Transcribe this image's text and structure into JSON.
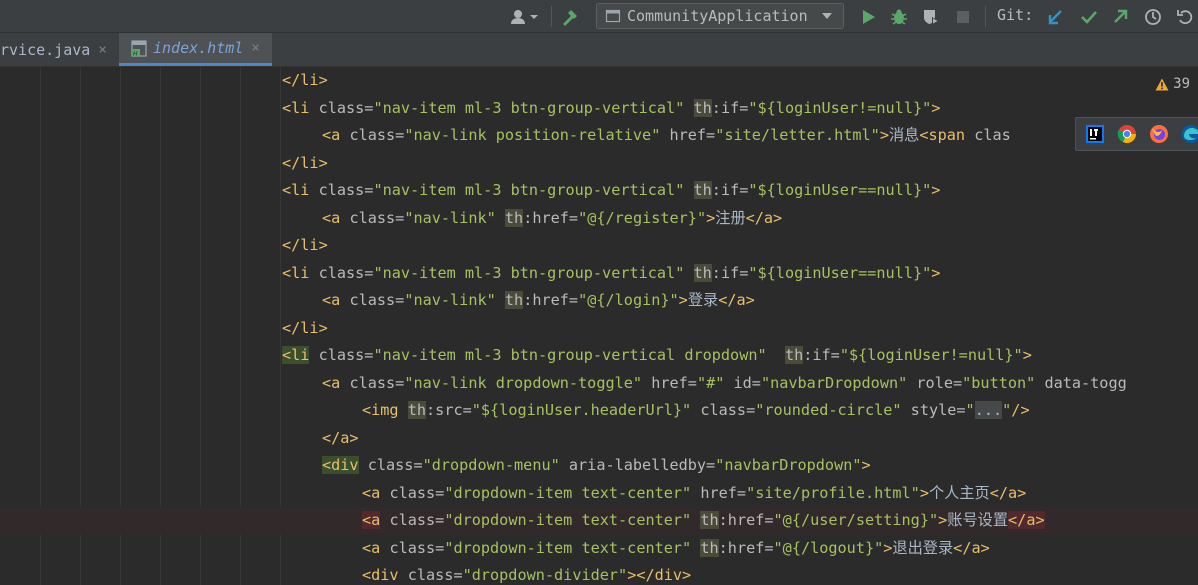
{
  "toolbar": {
    "run_config": "CommunityApplication",
    "git_label": "Git:",
    "icons": [
      "user-icon",
      "build-hammer-icon",
      "run-icon",
      "debug-icon",
      "coverage-icon",
      "stop-icon",
      "git-update-icon",
      "git-commit-icon",
      "git-push-icon",
      "history-icon",
      "rollback-icon"
    ],
    "colors": {
      "run": "#59a869",
      "debug": "#59a869",
      "git_update": "#3592c4",
      "git_commit": "#59a869",
      "git_push": "#59a869"
    }
  },
  "tabs": [
    {
      "label": "rvice.java",
      "close": "×",
      "active": false
    },
    {
      "label": "index.html",
      "close": "×",
      "active": true
    }
  ],
  "editor": {
    "warning_count": "39",
    "browsers": [
      "intellij-icon",
      "chrome-icon",
      "firefox-icon",
      "edge-icon"
    ],
    "lines": [
      {
        "t1": "</li>"
      },
      {
        "t1": "<li",
        "a1": " class=",
        "v1": "\"nav-item ml-3 btn-group-vertical\"",
        "sp": " ",
        "ns": "th",
        "a2": ":if=",
        "v2": "\"${loginUser!=null}\"",
        "t2": ">"
      },
      {
        "t1": "<a",
        "a1": " class=",
        "v1": "\"nav-link position-relative\"",
        "a2": " href=",
        "v2": "\"site/letter.html\"",
        "t2": ">",
        "x": "消息",
        "t3": "<span",
        "a3": " clas"
      },
      {
        "t1": "</li>"
      },
      {
        "t1": "<li",
        "a1": " class=",
        "v1": "\"nav-item ml-3 btn-group-vertical\"",
        "sp": " ",
        "ns": "th",
        "a2": ":if=",
        "v2": "\"${loginUser==null}\"",
        "t2": ">"
      },
      {
        "t1": "<a",
        "a1": " class=",
        "v1": "\"nav-link\"",
        "sp": " ",
        "ns": "th",
        "a2": ":href=",
        "v2": "\"@{/register}\"",
        "t2": ">",
        "x": "注册",
        "t3": "</a>"
      },
      {
        "t1": "</li>"
      },
      {
        "t1": "<li",
        "a1": " class=",
        "v1": "\"nav-item ml-3 btn-group-vertical\"",
        "sp": " ",
        "ns": "th",
        "a2": ":if=",
        "v2": "\"${loginUser==null}\"",
        "t2": ">"
      },
      {
        "t1": "<a",
        "a1": " class=",
        "v1": "\"nav-link\"",
        "sp": " ",
        "ns": "th",
        "a2": ":href=",
        "v2": "\"@{/login}\"",
        "t2": ">",
        "x": "登录",
        "t3": "</a>"
      },
      {
        "t1": "</li>"
      },
      {
        "t1": "<li",
        "a1": " class=",
        "v1": "\"nav-item ml-3 btn-group-vertical dropdown\"",
        "sp": "  ",
        "ns": "th",
        "a2": ":if=",
        "v2": "\"${loginUser!=null}\"",
        "t2": ">"
      },
      {
        "t1": "<a",
        "a1": " class=",
        "v1": "\"nav-link dropdown-toggle\"",
        "a2": " href=",
        "v2": "\"#\"",
        "a3": " id=",
        "v3": "\"navbarDropdown\"",
        "a4": " role=",
        "v4": "\"button\"",
        "a5": " data-togg"
      },
      {
        "t1": "<img",
        "sp": " ",
        "ns": "th",
        "a2": ":src=",
        "v2": "\"${loginUser.headerUrl}\"",
        "a3": " class=",
        "v3": "\"rounded-circle\"",
        "a4": " style=",
        "v4": "\"",
        "dots": "...",
        "v5": "\"",
        "t2": "/>"
      },
      {
        "t1": "</a>"
      },
      {
        "t1": "<div",
        "a1": " class=",
        "v1": "\"dropdown-menu\"",
        "a2": " aria-labelledby=",
        "v2": "\"navbarDropdown\"",
        "t2": ">"
      },
      {
        "t1": "<a",
        "a1": " class=",
        "v1": "\"dropdown-item text-center\"",
        "a2": " href=",
        "v2": "\"site/profile.html\"",
        "t2": ">",
        "x": "个人主页",
        "t3": "</a>"
      },
      {
        "t1": "<a",
        "a1": " class=",
        "v1": "\"dropdown-item text-center\"",
        "sp": " ",
        "ns": "th",
        "a2": ":href=",
        "v2": "\"@{/user/setting}\"",
        "t2": ">",
        "x": "账号设置",
        "t3": "</a>"
      },
      {
        "t1": "<a",
        "a1": " class=",
        "v1": "\"dropdown-item text-center\"",
        "sp": " ",
        "ns": "th",
        "a2": ":href=",
        "v2": "\"@{/logout}\"",
        "t2": ">",
        "x": "退出登录",
        "t3": "</a>"
      },
      {
        "t1": "<div",
        "a1": " class=",
        "v1": "\"dropdown-divider\"",
        "t2": "></div>"
      }
    ]
  }
}
